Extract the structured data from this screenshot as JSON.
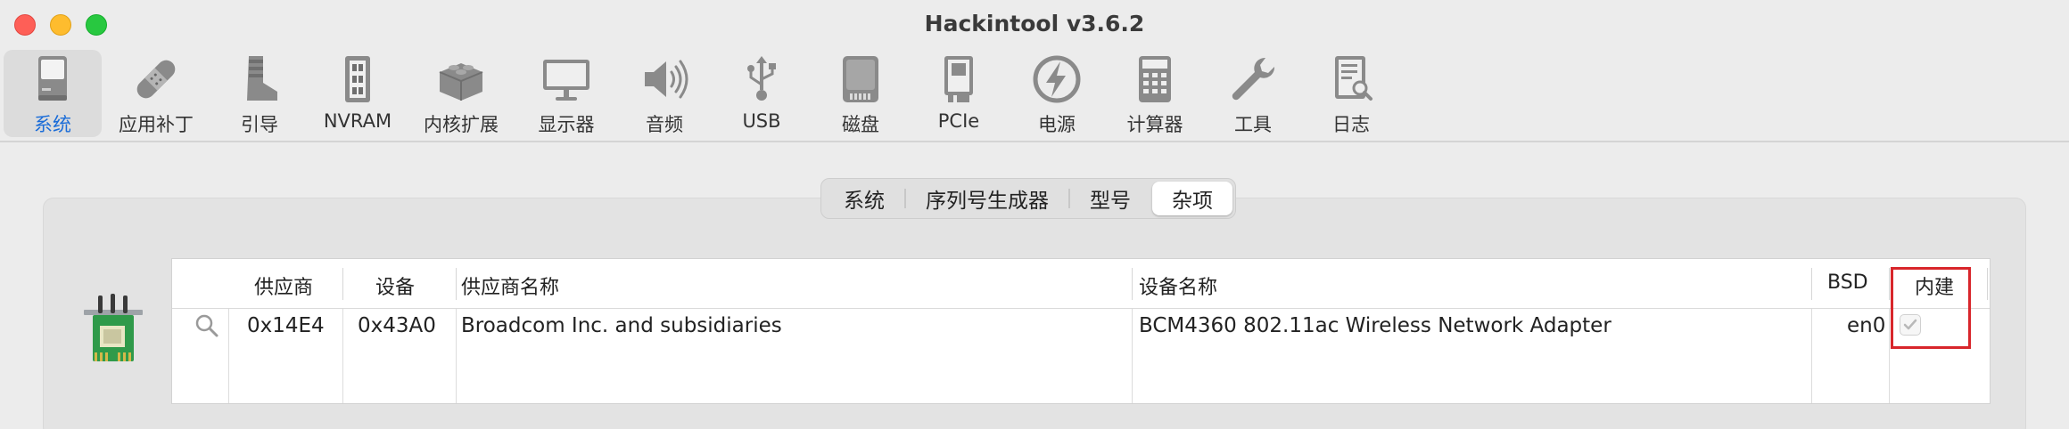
{
  "window": {
    "title": "Hackintool v3.6.2"
  },
  "toolbar": {
    "items": [
      {
        "label": "系统",
        "icon": "computer-icon",
        "active": true
      },
      {
        "label": "应用补丁",
        "icon": "bandage-icon",
        "active": false
      },
      {
        "label": "引导",
        "icon": "boot-icon",
        "active": false
      },
      {
        "label": "NVRAM",
        "icon": "ram-chip-icon",
        "active": false
      },
      {
        "label": "内核扩展",
        "icon": "lego-brick-icon",
        "active": false
      },
      {
        "label": "显示器",
        "icon": "display-icon",
        "active": false
      },
      {
        "label": "音频",
        "icon": "speaker-icon",
        "active": false
      },
      {
        "label": "USB",
        "icon": "usb-icon",
        "active": false
      },
      {
        "label": "磁盘",
        "icon": "disk-icon",
        "active": false
      },
      {
        "label": "PCIe",
        "icon": "pcie-card-icon",
        "active": false
      },
      {
        "label": "电源",
        "icon": "lightning-icon",
        "active": false
      },
      {
        "label": "计算器",
        "icon": "calculator-icon",
        "active": false
      },
      {
        "label": "工具",
        "icon": "wrench-icon",
        "active": false
      },
      {
        "label": "日志",
        "icon": "log-document-icon",
        "active": false
      }
    ]
  },
  "tabs": [
    {
      "label": "系统",
      "selected": false
    },
    {
      "label": "序列号生成器",
      "selected": false
    },
    {
      "label": "型号",
      "selected": false
    },
    {
      "label": "杂项",
      "selected": true
    }
  ],
  "table": {
    "columns": [
      "供应商",
      "设备",
      "供应商名称",
      "设备名称",
      "BSD",
      "内建"
    ],
    "rows": [
      {
        "vendor_id": "0x14E4",
        "device_id": "0x43A0",
        "vendor_name": "Broadcom Inc. and subsidiaries",
        "device_name": "BCM4360 802.11ac Wireless Network Adapter",
        "bsd": "en0",
        "builtin": true
      }
    ]
  },
  "colors": {
    "accent": "#1a6cd8",
    "highlight": "#d8262b"
  }
}
